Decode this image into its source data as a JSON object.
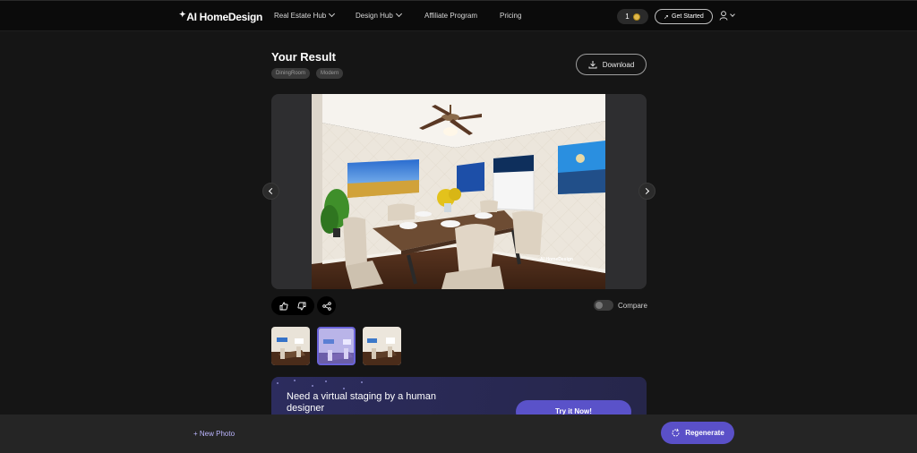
{
  "header": {
    "logo_text": "AI HomeDesign",
    "nav": [
      {
        "label": "Real Estate Hub",
        "has_dropdown": true
      },
      {
        "label": "Design Hub",
        "has_dropdown": true
      },
      {
        "label": "Affiliate Program",
        "has_dropdown": false
      },
      {
        "label": "Pricing",
        "has_dropdown": false
      }
    ],
    "credits": "1",
    "get_started": "Get Started"
  },
  "result": {
    "title": "Your Result",
    "tags": [
      "DiningRoom",
      "Modern"
    ],
    "download_label": "Download",
    "watermark": "AI HomeDesign",
    "compare_label": "Compare"
  },
  "promo": {
    "text": "Need a virtual staging by a human designer",
    "button": "Try it Now!"
  },
  "footer": {
    "new_photo": "+ New Photo",
    "regenerate": "Regenerate"
  },
  "colors": {
    "accent": "#5a52c9",
    "background": "#151515",
    "header": "#0b0b0b"
  }
}
